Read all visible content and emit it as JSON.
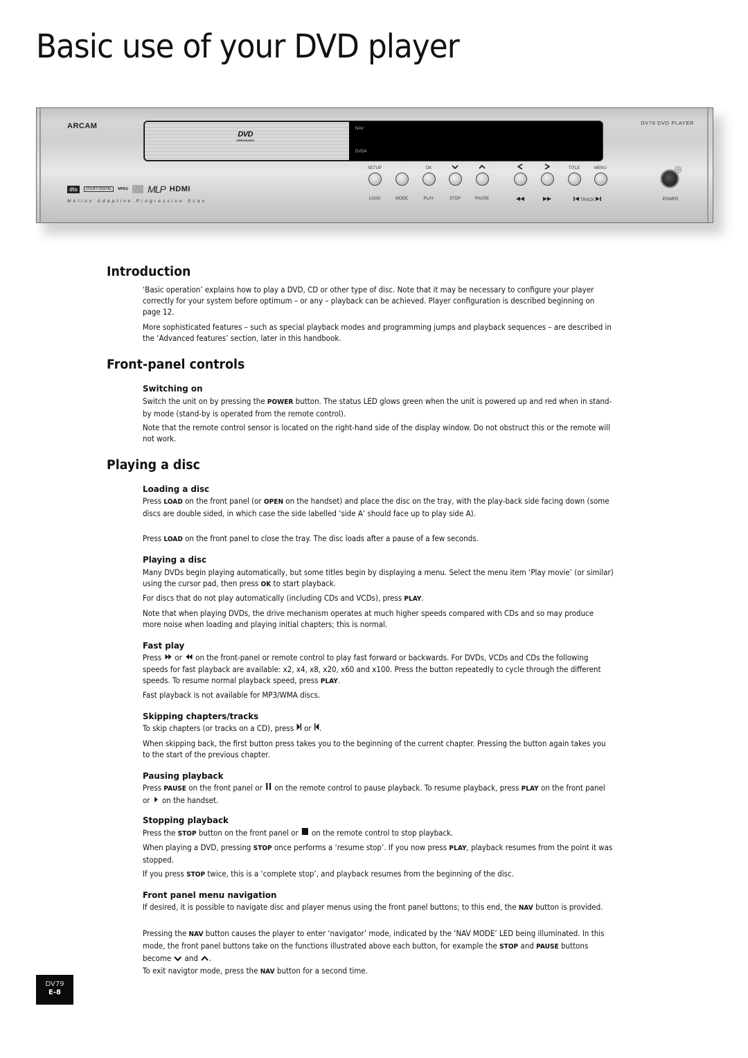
{
  "page": {
    "title": "Basic use of your DVD player",
    "footer": {
      "model": "DV79",
      "page_number": "E-8"
    }
  },
  "front_panel": {
    "brand": "ARCAM",
    "model_label": "DV79 DVD PLAYER",
    "display": {
      "logo_text": "DVD",
      "logo_subtext": "VIDEO/AUDIO",
      "indicator_top": "NAV",
      "indicator_bottom": "DVDA"
    },
    "format_logos": [
      "dts",
      "DOLBY DIGITAL",
      "MPEG",
      "Compact Disc",
      "MLP",
      "HDMI"
    ],
    "tagline": "Motion Adaptive Progressive Scan",
    "buttons": [
      {
        "top_label": "SETUP",
        "bottom_label": "LOAD"
      },
      {
        "top_label": "",
        "bottom_label": "MODE"
      },
      {
        "top_label": "OK",
        "bottom_label": "PLAY"
      },
      {
        "top_label": "⌄",
        "bottom_label": "STOP"
      },
      {
        "top_label": "^",
        "bottom_label": "PAUSE"
      },
      {
        "top_label": "<",
        "bottom_label": "◄◄"
      },
      {
        "top_label": ">",
        "bottom_label": "►►"
      },
      {
        "top_label": "TITLE",
        "bottom_label": ""
      },
      {
        "top_label": "MENU",
        "bottom_label": ""
      }
    ],
    "track_label": "TRACK",
    "power_label": "POWER"
  },
  "sections": {
    "introduction": {
      "heading": "Introduction",
      "paragraphs": [
        "‘Basic operation’ explains how to play a DVD, CD or other type of disc. Note that it may be necessary to configure your player correctly for your system before optimum – or any – playback can be achieved. Player configuration is described beginning on page 12.",
        "More sophisticated features – such as special playback modes and programming jumps and playback sequences – are described in the ‘Advanced features’ section, later in this handbook."
      ]
    },
    "front_panel_controls": {
      "heading": "Front-panel controls",
      "switching_on": {
        "heading": "Switching on",
        "p1_a": "Switch the unit on by pressing the ",
        "p1_k": "POWER",
        "p1_b": " button. The status LED glows green when the unit is powered up and red when in stand-by mode (stand-by is operated from the remote control).",
        "p2": "Note that the remote control sensor is located on the right-hand side of the display window. Do not obstruct this or the remote will not work."
      }
    },
    "playing_a_disc": {
      "heading": "Playing a disc",
      "loading": {
        "heading": "Loading a disc",
        "p1_a": "Press ",
        "p1_k1": "LOAD",
        "p1_b": " on the front panel (or ",
        "p1_k2": "OPEN",
        "p1_c": " on the handset) and place the disc on the tray, with the play-back side facing down (some discs are double sided, in which case the side labelled ‘side A’ should face up to play side A).",
        "p2_a": "Press ",
        "p2_k": "LOAD",
        "p2_b": " on the front panel to close the tray. The disc loads after a pause of a few seconds."
      },
      "playing": {
        "heading": "Playing a disc",
        "p1_a": "Many DVDs begin playing automatically, but some titles begin by displaying a menu. Select the menu item ‘Play movie’ (or similar) using the cursor pad, then press ",
        "p1_k": "OK",
        "p1_b": " to start playback.",
        "p2_a": "For discs that do not play automatically (including CDs and VCDs), press ",
        "p2_k": "PLAY",
        "p2_b": ".",
        "p3": "Note that when playing DVDs, the drive mechanism operates at much higher speeds compared with CDs and so may produce more noise when loading and playing initial chapters; this is normal."
      },
      "fast_play": {
        "heading": "Fast play",
        "p1_a": "Press ",
        "p1_or": " or ",
        "p1_b": " on the front-panel or remote control to play fast forward or backwards. For DVDs, VCDs and CDs the following speeds for fast playback are available: x2, x4, x8, x20, x60 and x100. Press the button repeatedly to cycle through the different speeds. To resume normal playback speed, press ",
        "p1_k": "PLAY",
        "p1_c": ".",
        "p2": "Fast playback is not available for MP3/WMA discs."
      },
      "skipping": {
        "heading": "Skipping chapters/tracks",
        "p1_a": "To skip chapters (or tracks on a CD), press ",
        "p1_or": " or ",
        "p1_b": ".",
        "p2": "When skipping back, the first button press takes you to the beginning of the current chapter. Pressing the button again takes you to the start of the previous chapter."
      },
      "pausing": {
        "heading": "Pausing playback",
        "p1_a": "Press ",
        "p1_k1": "PAUSE",
        "p1_b": " on the front panel or ",
        "p1_c": " on the remote control to pause playback. To resume playback, press ",
        "p1_k2": "PLAY",
        "p1_d": " on the front panel or ",
        "p1_e": " on the handset."
      },
      "stopping": {
        "heading": "Stopping playback",
        "p1_a": "Press the ",
        "p1_k": "STOP",
        "p1_b": " button on the front panel or ",
        "p1_c": " on the remote control to stop playback.",
        "p2_a": "When playing a DVD, pressing ",
        "p2_k1": "STOP",
        "p2_b": " once performs a ‘resume stop’. If you now press ",
        "p2_k2": "PLAY",
        "p2_c": ", playback resumes from the point it was stopped.",
        "p3_a": "If you press ",
        "p3_k": "STOP",
        "p3_b": " twice, this is a ‘complete stop’, and playback resumes from the beginning of the disc."
      },
      "menu_nav": {
        "heading": "Front panel menu navigation",
        "p1_a": "If desired, it is possible to navigate disc and player menus using the front panel buttons; to this end, the ",
        "p1_k": "NAV",
        "p1_b": " button is provided.",
        "p2_a": "Pressing the ",
        "p2_k1": "NAV",
        "p2_b": " button causes the player to enter ‘navigator’ mode, indicated by the ‘NAV MODE’ LED being illuminated. In this mode, the front panel buttons take on the functions illustrated above each button, for example the ",
        "p2_k2": "STOP",
        "p2_c": " and ",
        "p2_k3": "PAUSE",
        "p2_d": " buttons become ",
        "p2_e": " and ",
        "p2_f": ".",
        "p3_a": "To exit navigtor mode, press the ",
        "p3_k": "NAV",
        "p3_b": " button for a second time."
      }
    }
  }
}
